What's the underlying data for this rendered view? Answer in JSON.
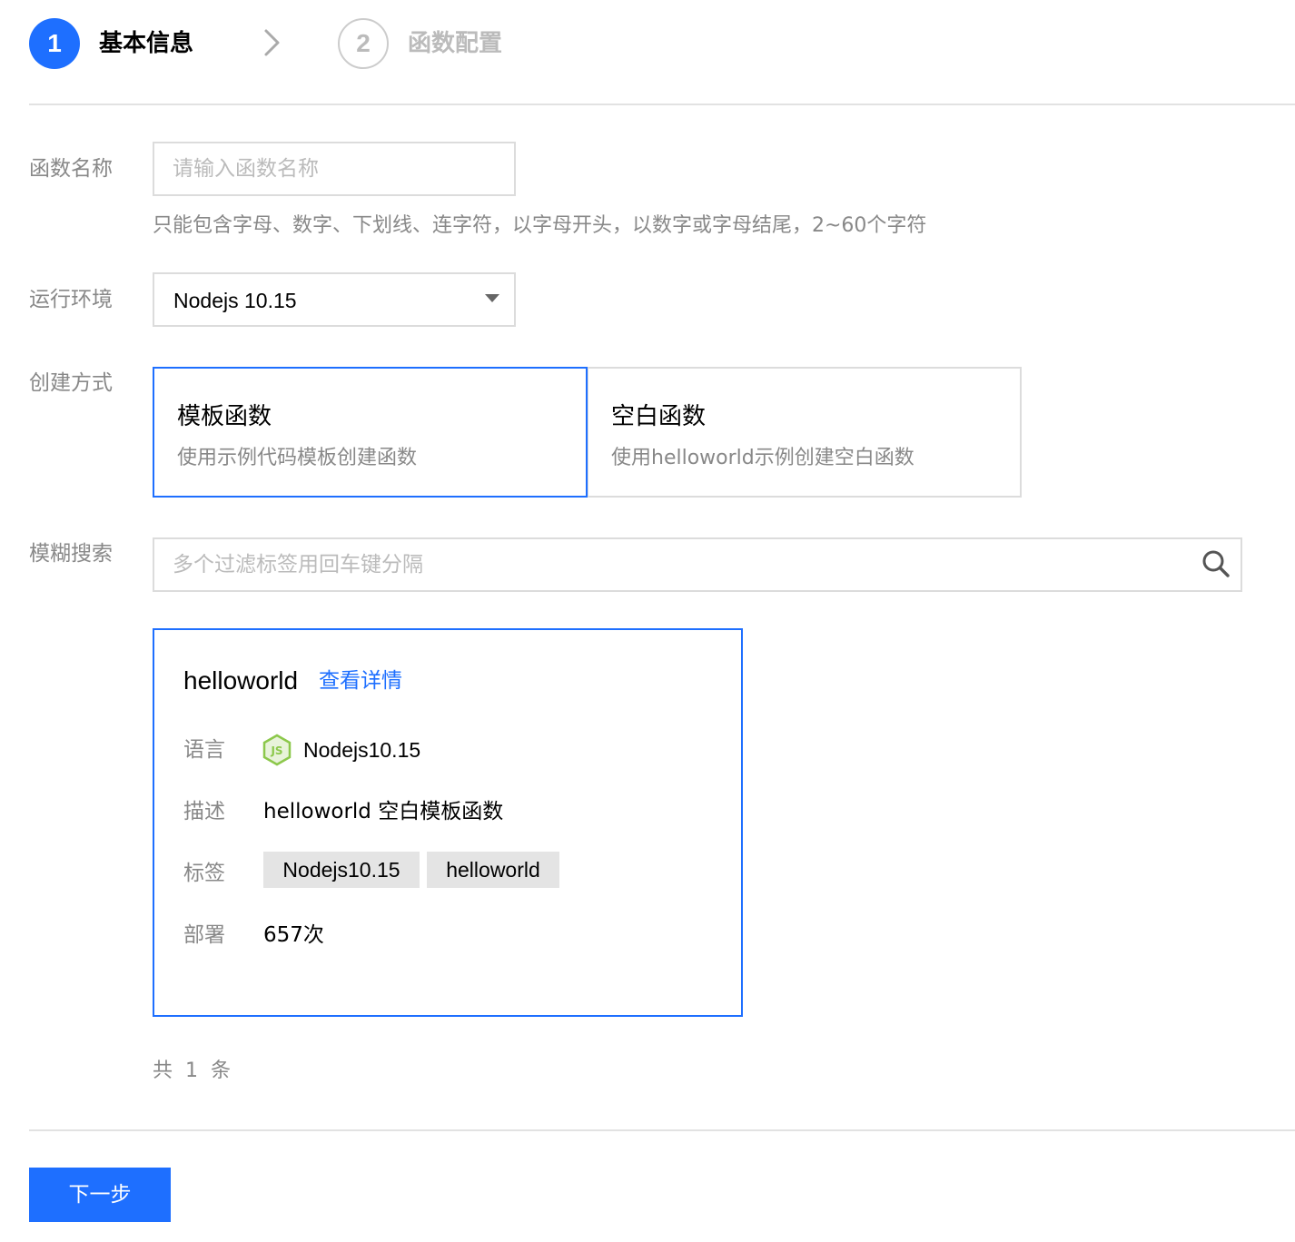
{
  "steps": [
    {
      "number": "1",
      "label": "基本信息",
      "state": "active"
    },
    {
      "number": "2",
      "label": "函数配置",
      "state": "inactive"
    }
  ],
  "form": {
    "name": {
      "label": "函数名称",
      "value": "",
      "placeholder": "请输入函数名称",
      "hint": "只能包含字母、数字、下划线、连字符，以字母开头，以数字或字母结尾，2~60个字符"
    },
    "runtime": {
      "label": "运行环境",
      "selected": "Nodejs 10.15"
    },
    "method": {
      "label": "创建方式",
      "options": [
        {
          "title": "模板函数",
          "desc": "使用示例代码模板创建函数",
          "selected": true
        },
        {
          "title": "空白函数",
          "desc": "使用helloworld示例创建空白函数",
          "selected": false
        }
      ]
    },
    "search": {
      "label": "模糊搜索",
      "value": "",
      "placeholder": "多个过滤标签用回车键分隔",
      "icon": "search-icon"
    }
  },
  "template": {
    "name": "helloworld",
    "detail_link": "查看详情",
    "language": {
      "label": "语言",
      "value": "Nodejs10.15",
      "icon": "nodejs-icon"
    },
    "description": {
      "label": "描述",
      "value": "helloworld 空白模板函数"
    },
    "tags": {
      "label": "标签",
      "items": [
        "Nodejs10.15",
        "helloworld"
      ]
    },
    "deploy": {
      "label": "部署",
      "value": "657次"
    }
  },
  "pagination": {
    "total_text": "共  1  条"
  },
  "footer": {
    "next_label": "下一步"
  },
  "colors": {
    "primary": "#1e6fff",
    "border": "#dcdcdc",
    "muted_text": "#888888",
    "tag_bg": "#e4e4e4",
    "nodejs_green": "#8cc84b"
  }
}
